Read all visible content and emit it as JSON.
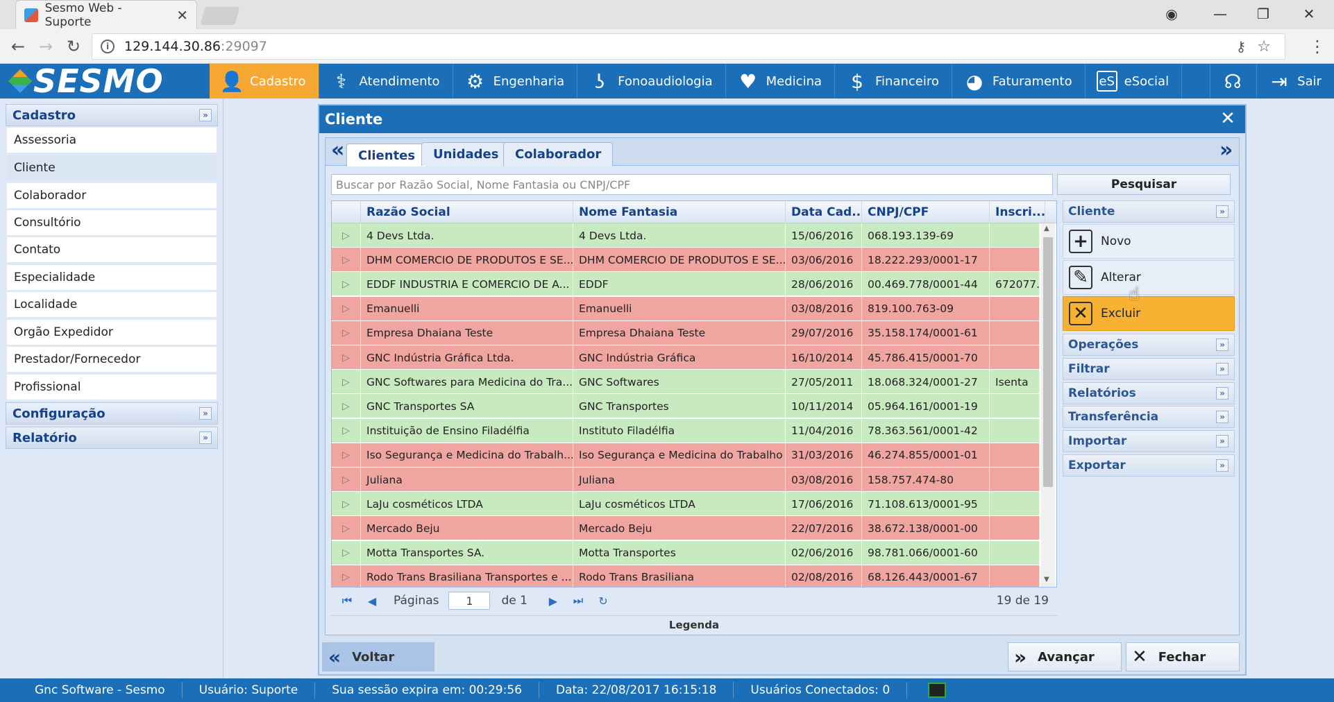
{
  "browser": {
    "tab_title": "Sesmo Web - Suporte",
    "url_host": "129.144.30.86",
    "url_port": ":29097"
  },
  "app": {
    "logo": "SESMO",
    "nav": [
      {
        "label": "Cadastro",
        "icon": "person-icon",
        "active": true
      },
      {
        "label": "Atendimento",
        "icon": "doctor-icon"
      },
      {
        "label": "Engenharia",
        "icon": "gear-icon"
      },
      {
        "label": "Fonoaudiologia",
        "icon": "ear-icon"
      },
      {
        "label": "Medicina",
        "icon": "heart-pulse-icon"
      },
      {
        "label": "Financeiro",
        "icon": "dollar-icon"
      },
      {
        "label": "Faturamento",
        "icon": "pie-chart-icon"
      },
      {
        "label": "eSocial",
        "icon": "esocial-icon"
      },
      {
        "label": "",
        "icon": "headset-icon"
      },
      {
        "label": "Sair",
        "icon": "exit-icon"
      }
    ]
  },
  "sidebar": {
    "cadastro_title": "Cadastro",
    "items": [
      "Assessoria",
      "Cliente",
      "Colaborador",
      "Consultório",
      "Contato",
      "Especialidade",
      "Localidade",
      "Orgão Expedidor",
      "Prestador/Fornecedor",
      "Profissional"
    ],
    "selected": "Cliente",
    "configuracao_title": "Configuração",
    "relatorio_title": "Relatório"
  },
  "dialog": {
    "title": "Cliente",
    "tabs": [
      "Clientes",
      "Unidades",
      "Colaborador"
    ],
    "search_placeholder": "Buscar por Razão Social, Nome Fantasia ou CNPJ/CPF",
    "search_button": "Pesquisar",
    "columns": [
      "Razão Social",
      "Nome Fantasia",
      "Data Cad...",
      "CNPJ/CPF",
      "Inscri..."
    ],
    "rows": [
      {
        "razao": "4 Devs Ltda.",
        "fantasia": "4 Devs Ltda.",
        "data": "15/06/2016",
        "cnpj": "068.193.139-69",
        "inscr": "",
        "status": "g"
      },
      {
        "razao": "DHM COMERCIO DE PRODUTOS E SE...",
        "fantasia": "DHM COMERCIO DE PRODUTOS E SE...",
        "data": "03/06/2016",
        "cnpj": "18.222.293/0001-17",
        "inscr": "",
        "status": "r"
      },
      {
        "razao": "EDDF INDUSTRIA E COMERCIO DE A...",
        "fantasia": "EDDF",
        "data": "28/06/2016",
        "cnpj": "00.469.778/0001-44",
        "inscr": "672077...",
        "status": "g"
      },
      {
        "razao": "Emanuelli",
        "fantasia": "Emanuelli",
        "data": "03/08/2016",
        "cnpj": "819.100.763-09",
        "inscr": "",
        "status": "r"
      },
      {
        "razao": "Empresa Dhaiana Teste",
        "fantasia": "Empresa Dhaiana Teste",
        "data": "29/07/2016",
        "cnpj": "35.158.174/0001-61",
        "inscr": "",
        "status": "r"
      },
      {
        "razao": "GNC Indústria Gráfica Ltda.",
        "fantasia": "GNC Indústria Gráfica",
        "data": "16/10/2014",
        "cnpj": "45.786.415/0001-70",
        "inscr": "",
        "status": "r"
      },
      {
        "razao": "GNC Softwares para Medicina do Tra...",
        "fantasia": "GNC Softwares",
        "data": "27/05/2011",
        "cnpj": "18.068.324/0001-27",
        "inscr": "Isenta",
        "status": "g"
      },
      {
        "razao": "GNC Transportes SA",
        "fantasia": "GNC Transportes",
        "data": "10/11/2014",
        "cnpj": "05.964.161/0001-19",
        "inscr": "",
        "status": "g"
      },
      {
        "razao": "Instituição de Ensino Filadélfia",
        "fantasia": "Instituto Filadélfia",
        "data": "11/04/2016",
        "cnpj": "78.363.561/0001-42",
        "inscr": "",
        "status": "g"
      },
      {
        "razao": "Iso Segurança e Medicina do Trabalh...",
        "fantasia": "Iso Segurança e Medicina do Trabalho",
        "data": "31/03/2016",
        "cnpj": "46.274.855/0001-01",
        "inscr": "",
        "status": "r"
      },
      {
        "razao": "Juliana",
        "fantasia": "Juliana",
        "data": "03/08/2016",
        "cnpj": "158.757.474-80",
        "inscr": "",
        "status": "r"
      },
      {
        "razao": "LaJu cosméticos LTDA",
        "fantasia": "LaJu cosméticos LTDA",
        "data": "17/06/2016",
        "cnpj": "71.108.613/0001-95",
        "inscr": "",
        "status": "g"
      },
      {
        "razao": "Mercado Beju",
        "fantasia": "Mercado Beju",
        "data": "22/07/2016",
        "cnpj": "38.672.138/0001-00",
        "inscr": "",
        "status": "r"
      },
      {
        "razao": "Motta Transportes SA.",
        "fantasia": "Motta Transportes",
        "data": "02/06/2016",
        "cnpj": "98.781.066/0001-60",
        "inscr": "",
        "status": "g"
      },
      {
        "razao": "Rodo Trans Brasiliana Transportes e ...",
        "fantasia": "Rodo Trans Brasiliana",
        "data": "02/08/2016",
        "cnpj": "68.126.443/0001-67",
        "inscr": "",
        "status": "r"
      }
    ],
    "pager": {
      "label": "Páginas",
      "page": "1",
      "of": "de 1",
      "count": "19 de 19"
    },
    "legend": "Legenda",
    "actions_title": "Cliente",
    "actions": [
      "Novo",
      "Alterar",
      "Excluir"
    ],
    "sections": [
      "Operações",
      "Filtrar",
      "Relatórios",
      "Transferência",
      "Importar",
      "Exportar"
    ],
    "back": "Voltar",
    "next": "Avançar",
    "close": "Fechar"
  },
  "status": {
    "company": "Gnc Software - Sesmo",
    "user": "Usuário: Suporte",
    "session": "Sua sessão expira em: 00:29:56",
    "date": "Data: 22/08/2017 16:15:18",
    "connected": "Usuários Conectados: 0"
  },
  "colors": {
    "primary": "#1a6fb8",
    "accent": "#f7a833",
    "ok_row": "#c8eac0",
    "bad_row": "#f1a5a0"
  }
}
